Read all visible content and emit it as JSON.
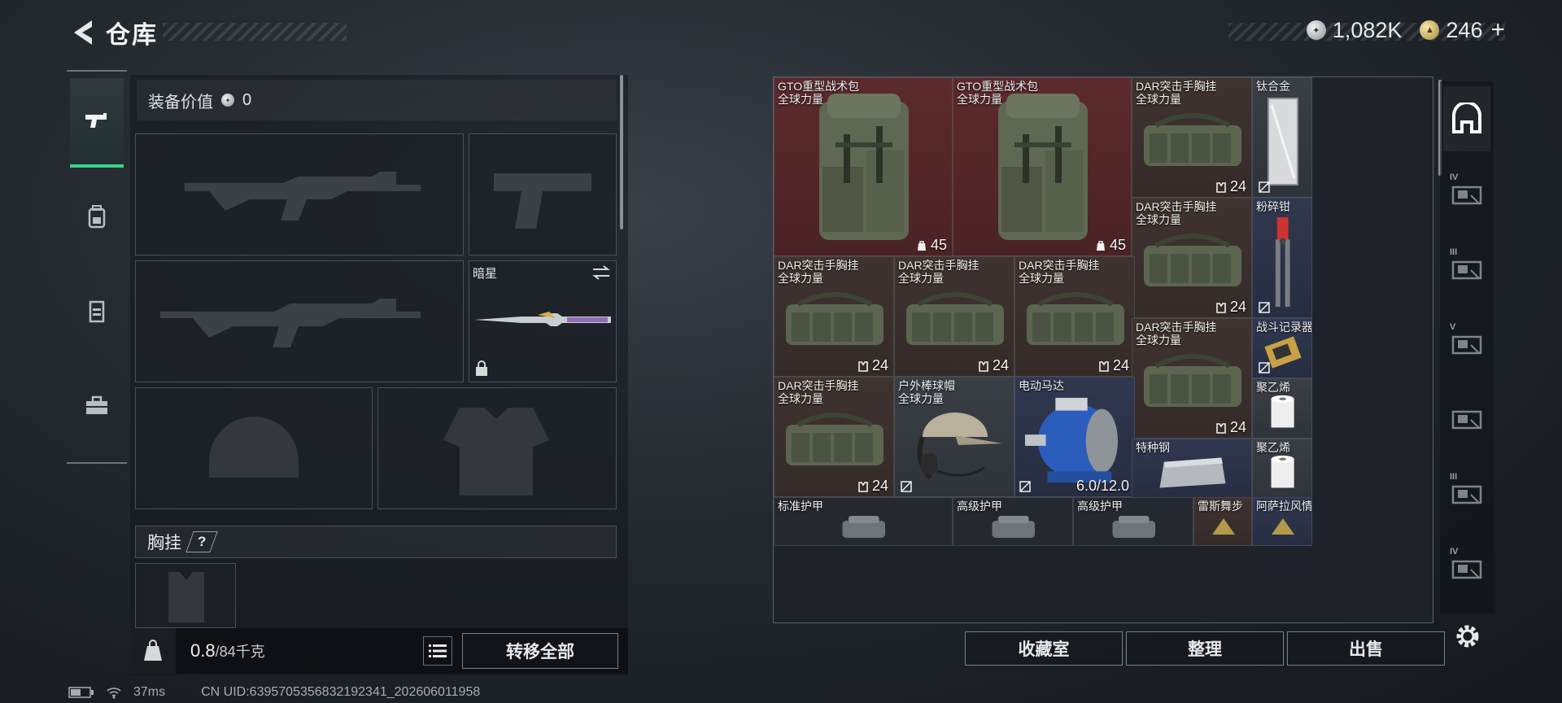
{
  "header": {
    "title": "仓库"
  },
  "currency": {
    "silver": "1,082K",
    "gold": "246",
    "gold_plus": "+"
  },
  "left_nav": [
    "weapon-tab",
    "backpack-tab",
    "rig-tab",
    "toolbox-tab"
  ],
  "equipment": {
    "value_label": "装备价值",
    "value": "0",
    "melee_name": "暗星",
    "rig_label": "胸挂",
    "help": "?"
  },
  "weight": {
    "current": "0.8",
    "max": "/84千克"
  },
  "transfer_all": "转移全部",
  "status": {
    "latency": "37ms",
    "uid": "CN UID:6395705356832192341_202606011958"
  },
  "grid": {
    "items": [
      {
        "name": "GTO重型战术包\n全球力量",
        "count": "45",
        "kind": "backpack"
      },
      {
        "name": "GTO重型战术包\n全球力量",
        "count": "45",
        "kind": "backpack"
      },
      {
        "name": "DAR突击手胸挂\n全球力量",
        "count": "24",
        "kind": "rig"
      },
      {
        "name": "钛合金",
        "count": "",
        "kind": "plate"
      },
      {
        "name": "DAR突击手胸挂\n全球力量",
        "count": "24",
        "kind": "rig"
      },
      {
        "name": "粉碎钳",
        "count": "",
        "kind": "tool"
      },
      {
        "name": "DAR突击手胸挂\n全球力量",
        "count": "24",
        "kind": "rig"
      },
      {
        "name": "DAR突击手胸挂\n全球力量",
        "count": "24",
        "kind": "rig"
      },
      {
        "name": "DAR突击手胸挂\n全球力量",
        "count": "24",
        "kind": "rig"
      },
      {
        "name": "DAR突击手胸挂\n全球力量",
        "count": "24",
        "kind": "rig"
      },
      {
        "name": "战斗记录器",
        "count": "",
        "kind": "recorder"
      },
      {
        "name": "DAR突击手胸挂\n全球力量",
        "count": "24",
        "kind": "rig"
      },
      {
        "name": "户外棒球帽\n全球力量",
        "count": "",
        "kind": "cap"
      },
      {
        "name": "电动马达",
        "count": "6.0/12.0",
        "kind": "motor"
      },
      {
        "name": "聚乙烯",
        "count": "",
        "kind": "roll"
      },
      {
        "name": "特种钢",
        "count": "",
        "kind": "steel"
      },
      {
        "name": "聚乙烯",
        "count": "",
        "kind": "roll"
      },
      {
        "name": "标准护甲",
        "count": "",
        "kind": "armor"
      },
      {
        "name": "高级护甲",
        "count": "",
        "kind": "armor"
      },
      {
        "name": "高级护甲",
        "count": "",
        "kind": "armor"
      },
      {
        "name": "雷斯舞步",
        "count": "",
        "kind": "misc"
      },
      {
        "name": "阿萨拉风情",
        "count": "",
        "kind": "misc"
      }
    ]
  },
  "side_tabs": [
    "home",
    "IV",
    "III",
    "V",
    "",
    "III",
    "IV"
  ],
  "buttons": {
    "collection": "收藏室",
    "organize": "整理",
    "sell": "出售"
  },
  "colors": {
    "accent": "#3fd28a",
    "red_cell": "#5c2a2c",
    "blue_cell": "#303850"
  }
}
